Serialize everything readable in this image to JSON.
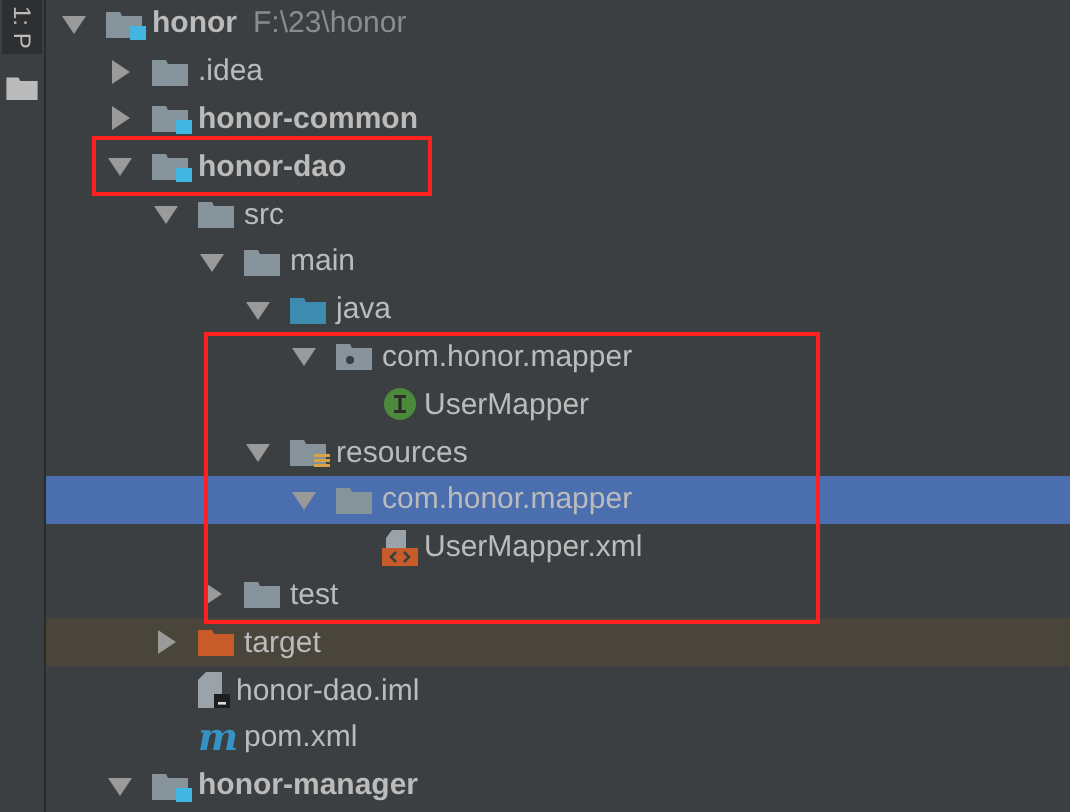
{
  "tool_strip": {
    "tab_label": "1: P"
  },
  "tree": [
    {
      "label": "honor",
      "path": "F:\\23\\honor",
      "kind": "module",
      "expanded": true,
      "selected": false,
      "children": [
        {
          "label": ".idea",
          "kind": "folder",
          "expanded": false,
          "selected": false
        },
        {
          "label": "honor-common",
          "kind": "module",
          "expanded": false,
          "selected": false
        },
        {
          "label": "honor-dao",
          "kind": "module",
          "expanded": true,
          "selected": false,
          "children": [
            {
              "label": "src",
              "kind": "folder",
              "expanded": true,
              "selected": false,
              "children": [
                {
                  "label": "main",
                  "kind": "folder",
                  "expanded": true,
                  "selected": false,
                  "children": [
                    {
                      "label": "java",
                      "kind": "source_folder",
                      "expanded": true,
                      "selected": false,
                      "children": [
                        {
                          "label": "com.honor.mapper",
                          "kind": "package",
                          "expanded": true,
                          "selected": false,
                          "children": [
                            {
                              "label": "UserMapper",
                              "kind": "interface",
                              "selected": false
                            }
                          ]
                        }
                      ]
                    },
                    {
                      "label": "resources",
                      "kind": "resource_folder",
                      "expanded": true,
                      "selected": false,
                      "children": [
                        {
                          "label": "com.honor.mapper",
                          "kind": "folder",
                          "expanded": true,
                          "selected": true,
                          "children": [
                            {
                              "label": "UserMapper.xml",
                              "kind": "xml",
                              "selected": false
                            }
                          ]
                        }
                      ]
                    }
                  ]
                },
                {
                  "label": "test",
                  "kind": "folder",
                  "expanded": false,
                  "selected": false
                }
              ]
            },
            {
              "label": "target",
              "kind": "excluded_folder",
              "expanded": false,
              "selected": false
            },
            {
              "label": "honor-dao.iml",
              "kind": "iml",
              "selected": false
            },
            {
              "label": "pom.xml",
              "kind": "maven",
              "icon_text": "m",
              "selected": false
            }
          ]
        },
        {
          "label": "honor-manager",
          "kind": "module",
          "expanded": true,
          "selected": false
        }
      ]
    }
  ],
  "annotation_frames": [
    {
      "color": "#ff2020"
    },
    {
      "color": "#ff2020"
    }
  ]
}
